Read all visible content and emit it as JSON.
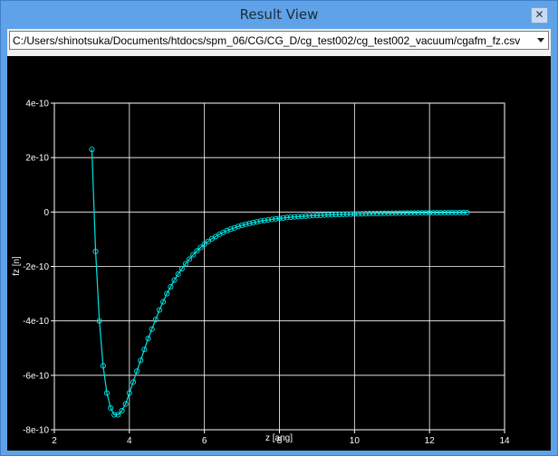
{
  "window": {
    "title": "Result View",
    "close_glyph": "✕"
  },
  "file_select": {
    "value": "C:/Users/shinotsuka/Documents/htdocs/spm_06/CG/CG_D/cg_test002/cg_test002_vacuum/cgafm_fz.csv"
  },
  "chart_data": {
    "type": "line",
    "xlabel": "z [ang]",
    "ylabel": "fz [n]",
    "xlim": [
      2,
      14
    ],
    "ylim": [
      -8e-10,
      4e-10
    ],
    "x_ticks": [
      "2",
      "4",
      "6",
      "8",
      "10",
      "12",
      "14"
    ],
    "y_ticks": [
      "4e-10",
      "2e-10",
      "0",
      "-2e-10",
      "-4e-10",
      "-6e-10",
      "-8e-10"
    ],
    "grid": true,
    "colors": {
      "background": "#000000",
      "axes": "#ffffff",
      "series": "#00e5e5"
    },
    "series": [
      {
        "marker": "circle",
        "x": [
          3.0,
          3.1,
          3.2,
          3.3,
          3.4,
          3.5,
          3.6,
          3.7,
          3.8,
          3.9,
          4.0,
          4.1,
          4.2,
          4.3,
          4.4,
          4.5,
          4.6,
          4.7,
          4.8,
          4.9,
          5.0,
          5.1,
          5.2,
          5.3,
          5.4,
          5.5,
          5.6,
          5.7,
          5.8,
          5.9,
          6.0,
          6.1,
          6.2,
          6.3,
          6.4,
          6.5,
          6.6,
          6.7,
          6.8,
          6.9,
          7.0,
          7.1,
          7.2,
          7.3,
          7.4,
          7.5,
          7.6,
          7.7,
          7.8,
          7.9,
          8.0,
          8.1,
          8.2,
          8.3,
          8.4,
          8.5,
          8.6,
          8.7,
          8.8,
          8.9,
          9.0,
          9.1,
          9.2,
          9.3,
          9.4,
          9.5,
          9.6,
          9.7,
          9.8,
          9.9,
          10.0,
          10.1,
          10.2,
          10.3,
          10.4,
          10.5,
          10.6,
          10.7,
          10.8,
          10.9,
          11.0,
          11.1,
          11.2,
          11.3,
          11.4,
          11.5,
          11.6,
          11.7,
          11.8,
          11.9,
          12.0,
          12.1,
          12.2,
          12.3,
          12.4,
          12.5,
          12.6,
          12.7,
          12.8,
          12.9,
          13.0
        ],
        "y": [
          2.3e-10,
          -1.45e-10,
          -4e-10,
          -5.65e-10,
          -6.65e-10,
          -7.2e-10,
          -7.45e-10,
          -7.45e-10,
          -7.3e-10,
          -7.05e-10,
          -6.65e-10,
          -6.25e-10,
          -5.85e-10,
          -5.45e-10,
          -5.05e-10,
          -4.65e-10,
          -4.3e-10,
          -3.95e-10,
          -3.6e-10,
          -3.3e-10,
          -3e-10,
          -2.75e-10,
          -2.5e-10,
          -2.28e-10,
          -2.08e-10,
          -1.9e-10,
          -1.73e-10,
          -1.57e-10,
          -1.43e-10,
          -1.3e-10,
          -1.18e-10,
          -1.08e-10,
          -9.8e-11,
          -9e-11,
          -8.2e-11,
          -7.5e-11,
          -6.9e-11,
          -6.3e-11,
          -5.8e-11,
          -5.3e-11,
          -4.9e-11,
          -4.5e-11,
          -4.2e-11,
          -3.9e-11,
          -3.6e-11,
          -3.3e-11,
          -3.1e-11,
          -2.9e-11,
          -2.7e-11,
          -2.5e-11,
          -2.3e-11,
          -2.2e-11,
          -2e-11,
          -1.9e-11,
          -1.8e-11,
          -1.7e-11,
          -1.6e-11,
          -1.5e-11,
          -1.4e-11,
          -1.3e-11,
          -1.25e-11,
          -1.2e-11,
          -1.1e-11,
          -1.05e-11,
          -1e-11,
          -9.5e-12,
          -9e-12,
          -8.5e-12,
          -8e-12,
          -7.6e-12,
          -7.2e-12,
          -6.8e-12,
          -6.5e-12,
          -6.2e-12,
          -5.9e-12,
          -5.6e-12,
          -5.3e-12,
          -5.1e-12,
          -4.9e-12,
          -4.7e-12,
          -4.5e-12,
          -4.3e-12,
          -4.1e-12,
          -3.9e-12,
          -3.8e-12,
          -3.6e-12,
          -3.5e-12,
          -3.3e-12,
          -3.2e-12,
          -3.1e-12,
          -3e-12,
          -2.9e-12,
          -2.8e-12,
          -2.7e-12,
          -2.6e-12,
          -2.5e-12,
          -2.4e-12,
          -2.3e-12,
          -2.2e-12,
          -2.1e-12,
          -2e-12
        ]
      }
    ]
  }
}
